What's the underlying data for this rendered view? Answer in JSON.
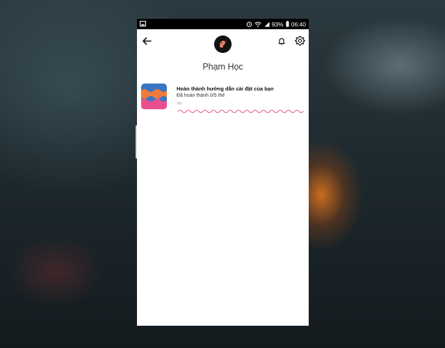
{
  "status_bar": {
    "battery_percent": "93%",
    "time": "06:40",
    "icons": [
      "image-icon",
      "alarm-icon",
      "wifi-icon",
      "signal-icon",
      "battery-icon"
    ]
  },
  "header": {
    "back_icon": "arrow-left-icon",
    "avatar": "profile-avatar",
    "notification_icon": "bell-icon",
    "settings_icon": "gear-icon"
  },
  "profile": {
    "name": "Phạm Học"
  },
  "card": {
    "title": "Hoàn thành hướng dẫn cài đặt của bạn",
    "subtitle": "Đã hoàn thành 0/5 thẻ",
    "time": "3m",
    "progress": 0
  },
  "colors": {
    "wave_pink": "#e9599b",
    "thumb_orange": "#f07a3a",
    "thumb_blue": "#3b76c5",
    "thumb_pink": "#e94f8f"
  }
}
